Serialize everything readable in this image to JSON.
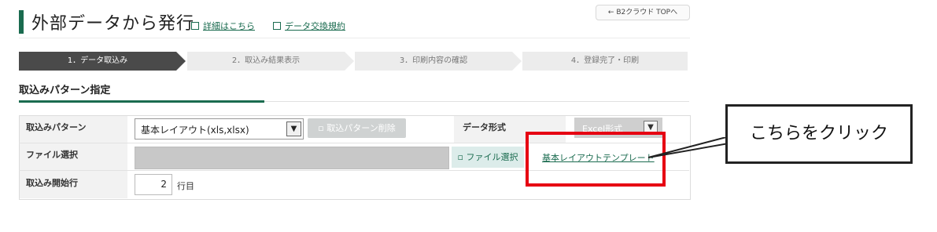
{
  "header": {
    "title": "外部データから発行",
    "links": [
      "詳細はこちら",
      "データ交換規約"
    ],
    "top_link": "B2クラウド TOPへ",
    "top_link_icon": "arrow-left-icon",
    "accent": "#1a6b4f"
  },
  "steps": [
    {
      "label": "1．データ取込み",
      "active": true
    },
    {
      "label": "2．取込み結果表示",
      "active": false
    },
    {
      "label": "3．印刷内容の確認",
      "active": false
    },
    {
      "label": "4．登録完了・印刷",
      "active": false
    }
  ],
  "section": {
    "title": "取込みパターン指定"
  },
  "form": {
    "pattern_label": "取込みパターン",
    "pattern_value": "基本レイアウト(xls,xlsx)",
    "delete_button": "取込パターン削除",
    "format_label": "データ形式",
    "format_value": "Excel形式",
    "file_label": "ファイル選択",
    "file_button": "ファイル選択",
    "template_link": "基本レイアウトテンプレート",
    "start_row_label": "取込み開始行",
    "start_row_value": "2",
    "start_row_unit": "行目"
  },
  "annotation": {
    "callout_text": "こちらをクリック",
    "highlight_color": "#e60012"
  }
}
